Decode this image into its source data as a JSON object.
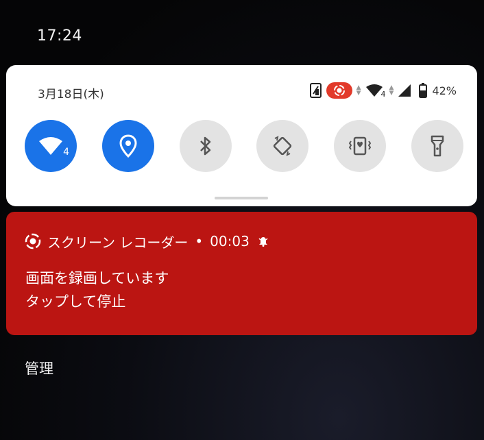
{
  "status_bar": {
    "time": "17:24"
  },
  "quick_settings": {
    "date": "3月18日(木)",
    "status_icons": [
      "nfc-icon",
      "screen-record-icon",
      "wifi-icon",
      "cell-signal-icon",
      "battery-icon"
    ],
    "wifi_badge": "4",
    "battery_percent": "42%",
    "tiles": [
      {
        "name": "wifi",
        "icon": "wifi-icon",
        "state": "on",
        "badge": "4"
      },
      {
        "name": "location",
        "icon": "location-pin-icon",
        "state": "on"
      },
      {
        "name": "bluetooth",
        "icon": "bluetooth-icon",
        "state": "off"
      },
      {
        "name": "auto-rotate",
        "icon": "auto-rotate-icon",
        "state": "off"
      },
      {
        "name": "vibrate",
        "icon": "vibrate-icon",
        "state": "off"
      },
      {
        "name": "flashlight",
        "icon": "flashlight-icon",
        "state": "off"
      }
    ]
  },
  "notification": {
    "app_name": "スクリーン レコーダー",
    "separator": "•",
    "elapsed": "00:03",
    "title": "画面を録画しています",
    "text": "タップして停止",
    "colors": {
      "background": "#bb1512"
    }
  },
  "footer": {
    "manage_label": "管理"
  },
  "colors": {
    "tile_on": "#1a73e8",
    "tile_off": "#e3e3e3",
    "rec_badge": "#e23a2a"
  }
}
